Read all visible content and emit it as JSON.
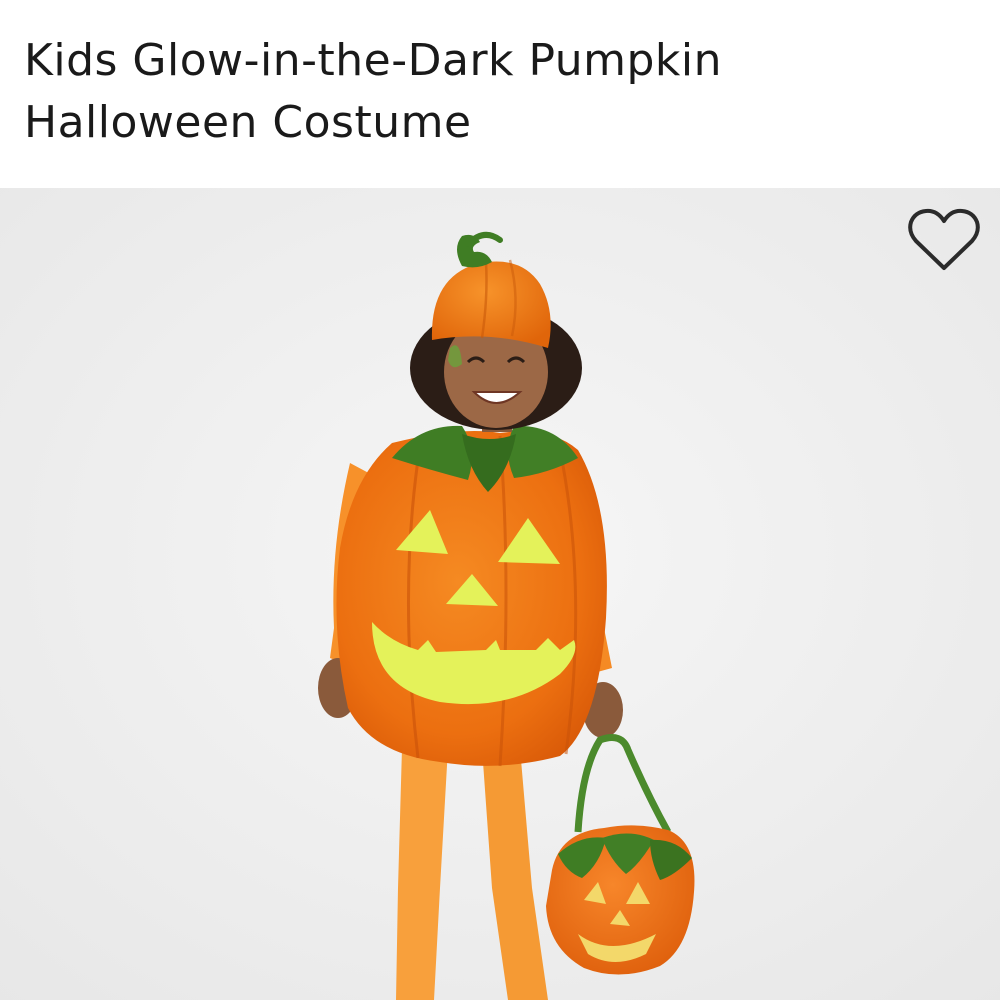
{
  "product": {
    "title": "Kids Glow-in-the-Dark Pumpkin Halloween Costume"
  },
  "image": {
    "alt": "Child wearing pumpkin costume holding a pumpkin treat bag"
  },
  "favorite": {
    "icon": "heart-outline-icon",
    "state": "not-favorited"
  },
  "colors": {
    "costume_orange": "#f07a12",
    "glow_yellow": "#e4f25a",
    "leaf_green": "#3f7d24",
    "background": "#efefef"
  }
}
